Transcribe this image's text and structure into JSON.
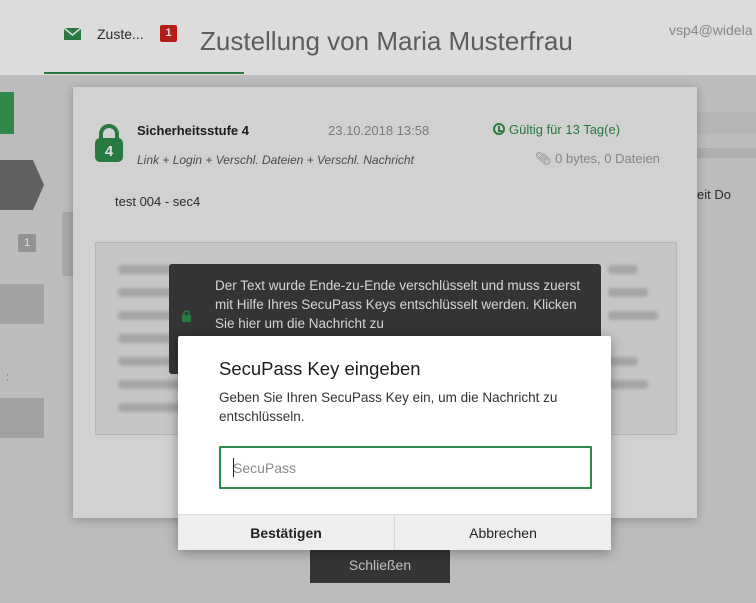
{
  "header": {
    "tab_label": "Zuste...",
    "tab_badge": "1",
    "title": "Zustellung von Maria Musterfrau",
    "user_email": "vsp4@widela"
  },
  "sidebar": {
    "badge": "1",
    "right_text": "eit   Do"
  },
  "message": {
    "security_level": "Sicherheitsstufe 4",
    "security_number": "4",
    "date": "23.10.2018 13:58",
    "validity": "Gültig für 13 Tag(e)",
    "description": "Link + Login + Verschl. Dateien + Verschl. Nachricht",
    "attachments": "0 bytes, 0 Dateien",
    "subject": "test 004 - sec4",
    "encrypted_notice": "Der Text wurde Ende-zu-Ende verschlüsselt und muss zuerst mit Hilfe Ihres SecuPass Keys entschlüsselt werden. Klicken Sie hier um die Nachricht zu",
    "close_label": "Schließen"
  },
  "dialog": {
    "title": "SecuPass Key eingeben",
    "description": "Geben Sie Ihren SecuPass Key ein, um die Nachricht zu entschlüsseln.",
    "input_placeholder": "SecuPass",
    "input_value": "",
    "confirm_label": "Bestätigen",
    "cancel_label": "Abbrechen"
  },
  "colors": {
    "accent": "#2e8b4a",
    "badge": "#d0211c"
  },
  "icons": {
    "mail": "mail-icon",
    "lock": "lock-icon",
    "clock": "clock-icon",
    "paperclip": "paperclip-icon"
  }
}
